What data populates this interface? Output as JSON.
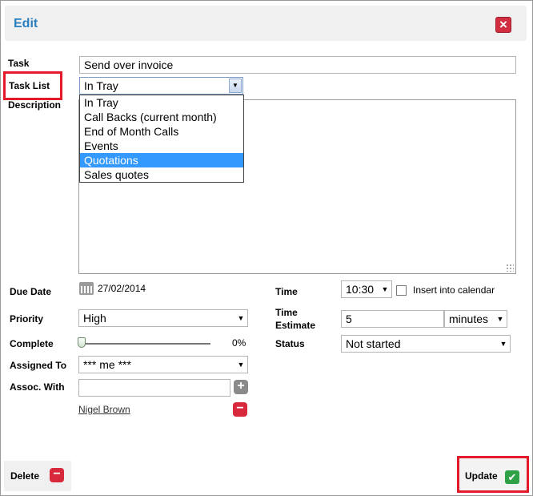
{
  "dialog": {
    "title": "Edit",
    "close_icon": "close-x-icon"
  },
  "form": {
    "task_label": "Task",
    "task_value": "Send over invoice",
    "tasklist_label": "Task List",
    "tasklist_value": "In Tray",
    "tasklist_options": [
      "In Tray",
      "Call Backs (current month)",
      "End of Month Calls",
      "Events",
      "Quotations",
      "Sales quotes"
    ],
    "tasklist_highlighted": "Quotations",
    "description_label": "Description",
    "due_date_label": "Due Date",
    "due_date_value": "27/02/2014",
    "time_label": "Time",
    "time_value": "10:30",
    "insert_calendar_label": "Insert into calendar",
    "priority_label": "Priority",
    "priority_value": "High",
    "time_estimate_label_1": "Time",
    "time_estimate_label_2": "Estimate",
    "time_estimate_value": "5",
    "time_estimate_unit": "minutes",
    "complete_label": "Complete",
    "complete_value": "0%",
    "status_label": "Status",
    "status_value": "Not started",
    "assigned_label": "Assigned To",
    "assigned_value": "*** me ***",
    "assoc_label": "Assoc. With",
    "assoc_value": "",
    "assoc_person": "Nigel Brown"
  },
  "footer": {
    "delete_label": "Delete",
    "update_label": "Update"
  },
  "colors": {
    "title": "#2a7fc0",
    "highlight": "#e31a2a",
    "selected_option": "#3399ff"
  }
}
